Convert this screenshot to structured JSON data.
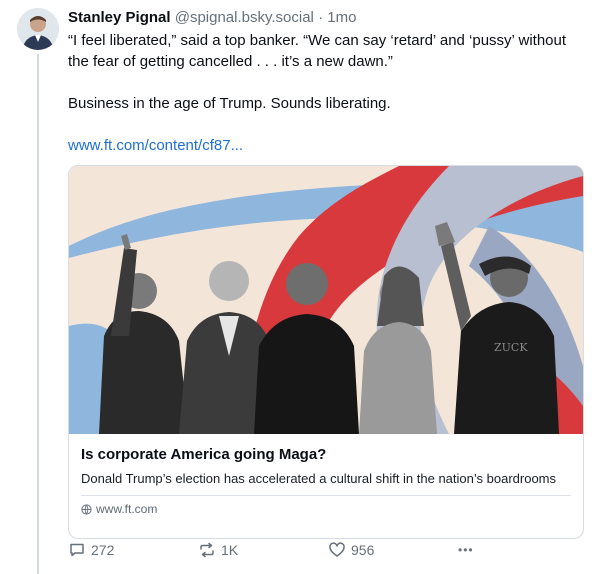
{
  "post": {
    "author": {
      "display_name": "Stanley Pignal",
      "handle": "@spignal.bsky.social",
      "separator": "·",
      "timestamp": "1mo"
    },
    "text_line1": "“I feel liberated,” said a top banker. “We can say ‘retard’ and ‘pussy’ without the fear of getting cancelled . . . it’s a new dawn.”",
    "text_line2": "Business in the age of Trump. Sounds liberating.",
    "link_text": "www.ft.com/content/cf87..."
  },
  "card": {
    "title": "Is corporate America going Maga?",
    "description": "Donald Trump’s election has accelerated a cultural shift in the nation’s boardrooms",
    "source": "www.ft.com",
    "image_colors": {
      "background": "#f3e6d9",
      "red": "#d8393c",
      "blue": "#8fb6dc",
      "slate": "#9aa7c2"
    }
  },
  "actions": {
    "replies": "272",
    "reposts": "1K",
    "likes": "956",
    "more_label": "•••"
  },
  "icons": [
    "reply-icon",
    "repost-icon",
    "like-icon",
    "more-icon",
    "globe-icon"
  ]
}
